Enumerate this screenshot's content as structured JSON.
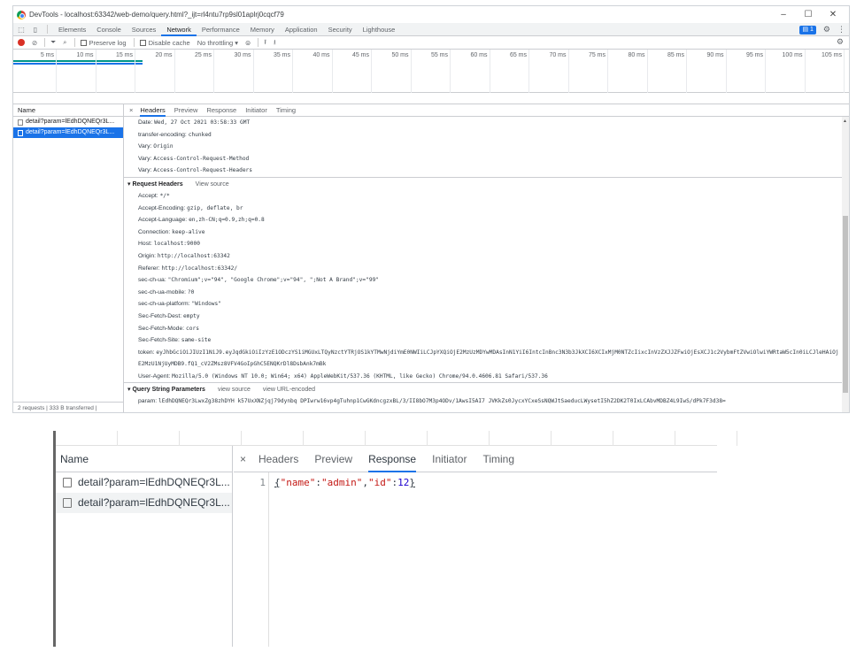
{
  "window": {
    "title": "DevTools - localhost:63342/web-demo/query.html?_ijt=rl4ntu7rp9sl01aplrj0cqcf79",
    "minimize": "–",
    "maximize": "☐",
    "close": "✕"
  },
  "tabs": {
    "items": [
      "Elements",
      "Console",
      "Sources",
      "Network",
      "Performance",
      "Memory",
      "Application",
      "Security",
      "Lighthouse"
    ],
    "active": "Network",
    "badge_count": "1"
  },
  "toolbar": {
    "preserve_log": "Preserve log",
    "disable_cache": "Disable cache",
    "throttling": "No throttling"
  },
  "timeline": {
    "ticks": [
      "5 ms",
      "10 ms",
      "15 ms",
      "20 ms",
      "25 ms",
      "30 ms",
      "35 ms",
      "40 ms",
      "45 ms",
      "50 ms",
      "55 ms",
      "60 ms",
      "65 ms",
      "70 ms",
      "75 ms",
      "80 ms",
      "85 ms",
      "90 ms",
      "95 ms",
      "100 ms",
      "105 ms",
      "110"
    ]
  },
  "requests": {
    "header": "Name",
    "rows": [
      "detail?param=lEdhDQNEQr3L...",
      "detail?param=lEdhDQNEQr3L..."
    ],
    "selected_index": 1,
    "status": "2 requests | 333 B transferred |"
  },
  "detail": {
    "close": "×",
    "tabs": [
      "Headers",
      "Preview",
      "Response",
      "Initiator",
      "Timing"
    ],
    "active_tab": "Headers",
    "response_headers": [
      {
        "k": "Date:",
        "v": "Wed, 27 Oct 2021 03:58:33 GMT"
      },
      {
        "k": "transfer-encoding:",
        "v": "chunked"
      },
      {
        "k": "Vary:",
        "v": "Origin"
      },
      {
        "k": "Vary:",
        "v": "Access-Control-Request-Method"
      },
      {
        "k": "Vary:",
        "v": "Access-Control-Request-Headers"
      }
    ],
    "request_section": {
      "title": "▾ Request Headers",
      "view_source": "View source"
    },
    "request_headers": [
      {
        "k": "Accept:",
        "v": "*/*"
      },
      {
        "k": "Accept-Encoding:",
        "v": "gzip, deflate, br"
      },
      {
        "k": "Accept-Language:",
        "v": "en,zh-CN;q=0.9,zh;q=0.8"
      },
      {
        "k": "Connection:",
        "v": "keep-alive"
      },
      {
        "k": "Host:",
        "v": "localhost:9000"
      },
      {
        "k": "Origin:",
        "v": "http://localhost:63342"
      },
      {
        "k": "Referer:",
        "v": "http://localhost:63342/"
      },
      {
        "k": "sec-ch-ua:",
        "v": "\"Chromium\";v=\"94\", \"Google Chrome\";v=\"94\", \";Not A Brand\";v=\"99\""
      },
      {
        "k": "sec-ch-ua-mobile:",
        "v": "?0"
      },
      {
        "k": "sec-ch-ua-platform:",
        "v": "\"Windows\""
      },
      {
        "k": "Sec-Fetch-Dest:",
        "v": "empty"
      },
      {
        "k": "Sec-Fetch-Mode:",
        "v": "cors"
      },
      {
        "k": "Sec-Fetch-Site:",
        "v": "same-site"
      }
    ],
    "token": {
      "k": "token:",
      "v": "eyJhbGciOiJIUzI1NiJ9.eyJqdGkiOiIzYzE1ODczYS1iMGUxLTQyNzctYTRjOS1kYTMwNjdiYmE0NWIiLCJpYXQiOjE2MzUzMDYwMDAsInN1YiI6IntcInBnc3N3b3JkXCI6XCIxMjM0NTZcIixcInVzZXJJZFwiOjEsXCJ1c2VybmFtZVwiOlwiYWRtaW5cIn0iLCJleHAiOjE2MzU1NjUyMDB9.fQ1_cV2ZMsz8VFV4GoIpGhC5ENQKrDl8DsbAnk7mBk"
    },
    "user_agent": {
      "k": "User-Agent:",
      "v": "Mozilla/5.0 (Windows NT 10.0; Win64; x64) AppleWebKit/537.36 (KHTML, like Gecko) Chrome/94.0.4606.81 Safari/537.36"
    },
    "query_section": {
      "title": "▾ Query String Parameters",
      "view_source": "view source",
      "view_url": "view URL-encoded"
    },
    "param": {
      "k": "param:",
      "v": "lEdhDQNEQr3LwxZg38zhDYH k57UxXNZjqj79dynbq DPIwrw16vp4gTuhnp1CwGKdncgzxBL/3/II8bO7M3p4ODv/1AwsI5AI7 JVKkZs0JycxYCxeSsNQWJtSaeducLWysetI5hZ2DK2T0IxLCAbvMDBZ4L9IwS/dPk7F3d38="
    }
  },
  "zoomed": {
    "name_header": "Name",
    "rows": [
      "detail?param=lEdhDQNEQr3L...",
      "detail?param=lEdhDQNEQr3L..."
    ],
    "close": "×",
    "tabs": [
      "Headers",
      "Preview",
      "Response",
      "Initiator",
      "Timing"
    ],
    "active_tab": "Response",
    "line_number": "1",
    "response_body": {
      "open": "{",
      "key1": "\"name\"",
      "val1": "\"admin\"",
      "key2": "\"id\"",
      "val2": "12",
      "close": "}"
    }
  }
}
